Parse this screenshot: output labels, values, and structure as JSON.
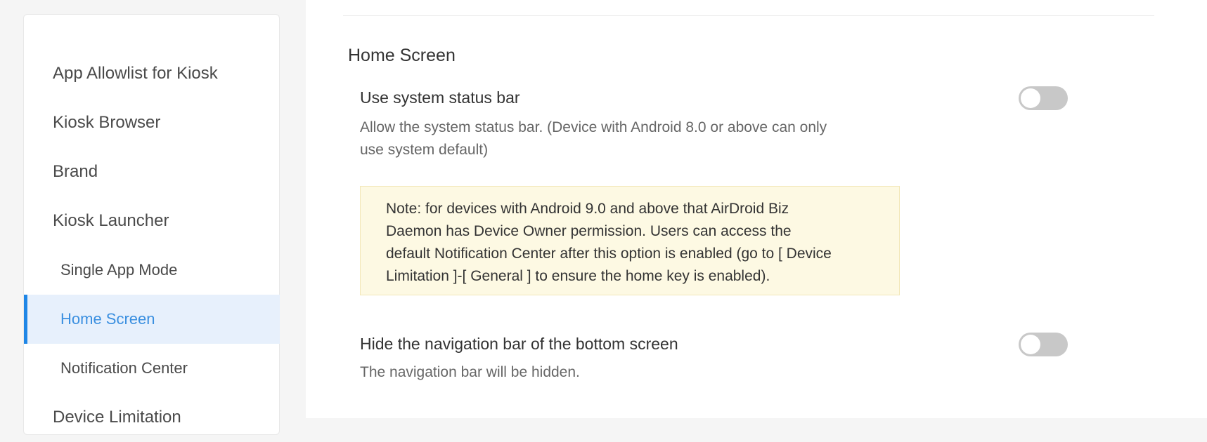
{
  "sidebar": {
    "items": [
      {
        "label": "App Allowlist for Kiosk",
        "level": "top",
        "active": false
      },
      {
        "label": "Kiosk Browser",
        "level": "top",
        "active": false
      },
      {
        "label": "Brand",
        "level": "top",
        "active": false
      },
      {
        "label": "Kiosk Launcher",
        "level": "top",
        "active": false
      },
      {
        "label": "Single App Mode",
        "level": "sub",
        "active": false
      },
      {
        "label": "Home Screen",
        "level": "sub",
        "active": true
      },
      {
        "label": "Notification Center",
        "level": "sub",
        "active": false
      },
      {
        "label": "Device Limitation",
        "level": "top",
        "active": false
      }
    ]
  },
  "main": {
    "section_title": "Home Screen",
    "settings": [
      {
        "title": "Use system status bar",
        "description_line1": "Allow the system status bar. (Device with Android 8.0 or above can only",
        "description_line2": "use system default)",
        "enabled": false
      },
      {
        "title": "Hide the navigation bar of the bottom screen",
        "description_line1": "The navigation bar will be hidden.",
        "enabled": false
      }
    ],
    "note": {
      "line1": "Note: for devices with Android 9.0 and above that AirDroid Biz",
      "line2": "Daemon has Device Owner permission. Users can access the",
      "line3": "default Notification Center after this option is enabled (go to [ Device",
      "line4": "Limitation ]-[ General ] to ensure the home key is enabled)."
    }
  },
  "colors": {
    "accent": "#1f86e6",
    "active_bg": "#e7f0fc",
    "note_bg": "#fdf9e3",
    "toggle_off": "#c8c8c8"
  }
}
